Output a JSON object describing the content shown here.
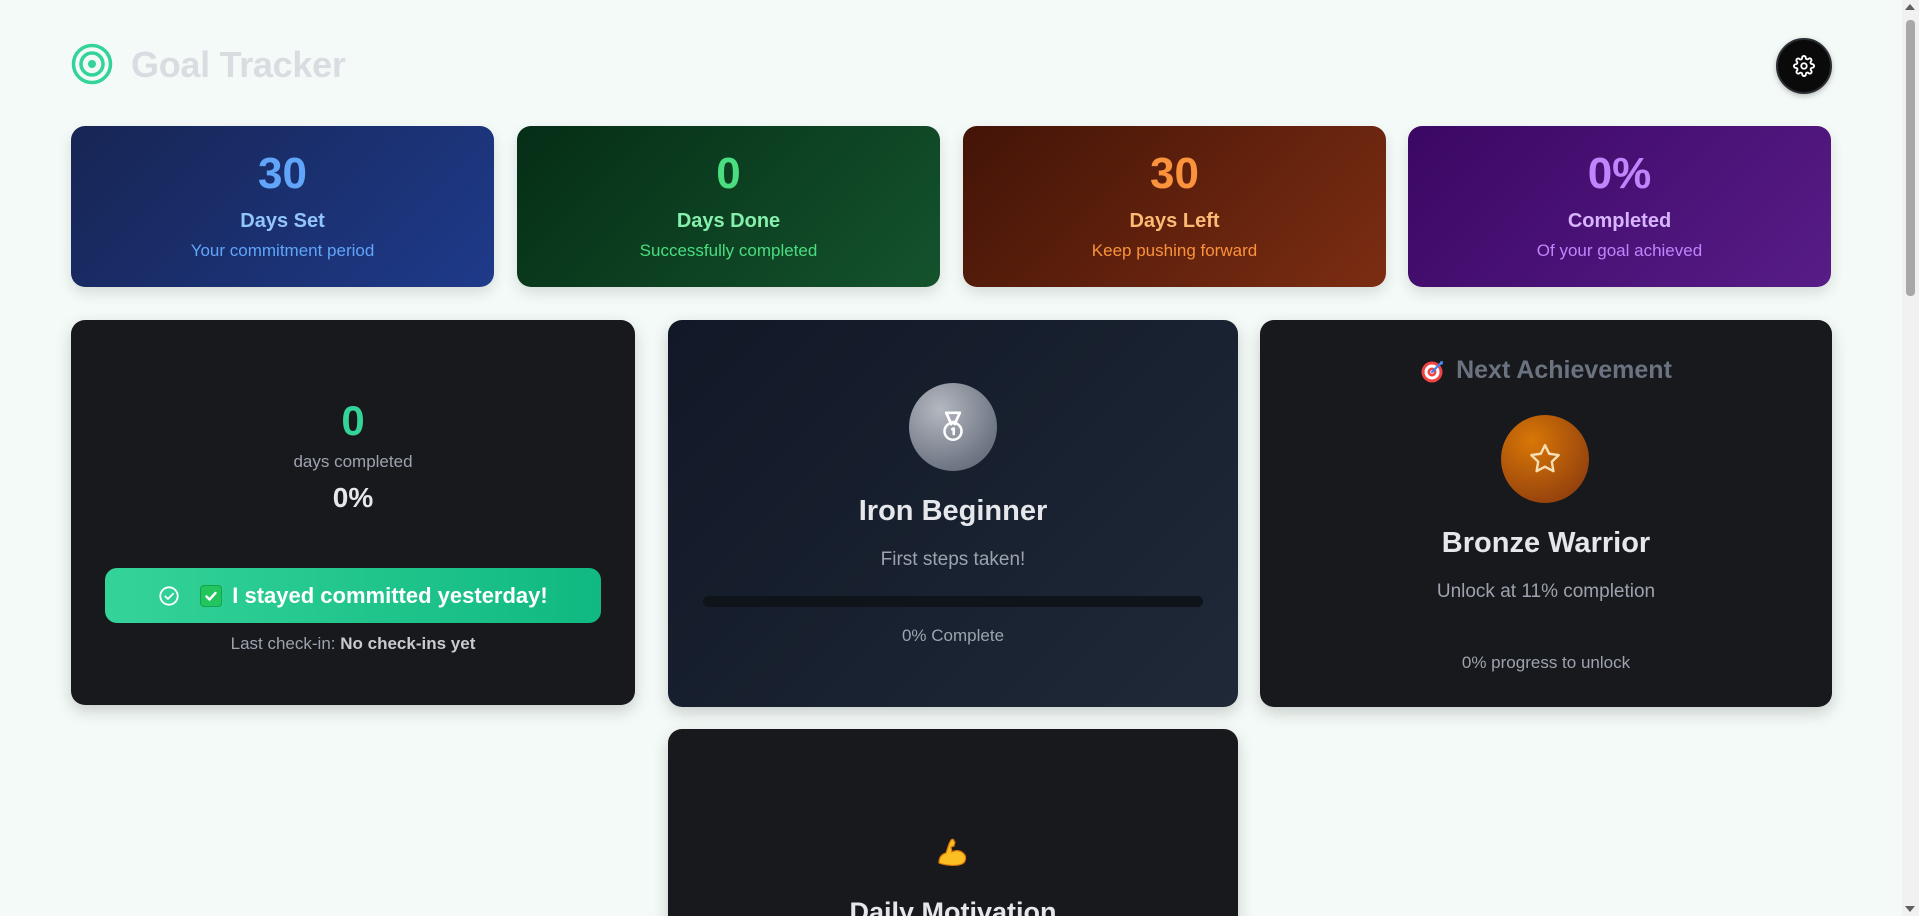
{
  "header": {
    "title": "Goal Tracker",
    "logo_icon": "target-icon",
    "settings_icon": "gear-icon"
  },
  "stats": [
    {
      "value": "30",
      "label": "Days Set",
      "sub": "Your commitment period",
      "color": "#60a5fa"
    },
    {
      "value": "0",
      "label": "Days Done",
      "sub": "Successfully completed",
      "color": "#4ade80"
    },
    {
      "value": "30",
      "label": "Days Left",
      "sub": "Keep pushing forward",
      "color": "#fb923c"
    },
    {
      "value": "0%",
      "label": "Completed",
      "sub": "Of your goal achieved",
      "color": "#c084fc"
    }
  ],
  "checkin": {
    "count": "0",
    "count_label": "days completed",
    "percent": "0%",
    "button_label": "I stayed committed yesterday!",
    "last_checkin_label": "Last check-in:",
    "last_checkin_value": "No check-ins yet"
  },
  "achievement": {
    "title": "Iron Beginner",
    "description": "First steps taken!",
    "progress": 0,
    "progress_text": "0% Complete"
  },
  "next_achievement": {
    "heading": "Next Achievement",
    "title": "Bronze Warrior",
    "description": "Unlock at 11% completion",
    "progress_text": "0% progress to unlock"
  },
  "motivation": {
    "icon": "flexed-biceps-icon",
    "title": "Daily Motivation"
  },
  "colors": {
    "accent": "#10b981",
    "background": "#f4faf7",
    "panel": "#18191c"
  }
}
